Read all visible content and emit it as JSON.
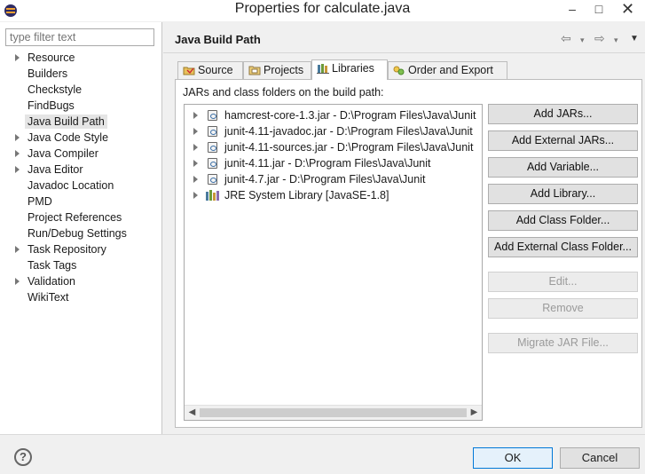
{
  "window": {
    "title": "Properties for calculate.java",
    "minimize": "–",
    "maximize": "□",
    "close": "✕"
  },
  "sidebar": {
    "filter_placeholder": "type filter text",
    "items": [
      {
        "label": "Resource",
        "expandable": true
      },
      {
        "label": "Builders",
        "expandable": false
      },
      {
        "label": "Checkstyle",
        "expandable": false
      },
      {
        "label": "FindBugs",
        "expandable": false
      },
      {
        "label": "Java Build Path",
        "expandable": false,
        "selected": true
      },
      {
        "label": "Java Code Style",
        "expandable": true
      },
      {
        "label": "Java Compiler",
        "expandable": true
      },
      {
        "label": "Java Editor",
        "expandable": true
      },
      {
        "label": "Javadoc Location",
        "expandable": false
      },
      {
        "label": "PMD",
        "expandable": false
      },
      {
        "label": "Project References",
        "expandable": false
      },
      {
        "label": "Run/Debug Settings",
        "expandable": false
      },
      {
        "label": "Task Repository",
        "expandable": true
      },
      {
        "label": "Task Tags",
        "expandable": false
      },
      {
        "label": "Validation",
        "expandable": true
      },
      {
        "label": "WikiText",
        "expandable": false
      }
    ]
  },
  "page": {
    "title": "Java Build Path",
    "nav": {
      "back": "⇦",
      "forward": "⇨",
      "dropdown": "▾",
      "menu": "▼"
    }
  },
  "tabs": [
    {
      "label": "Source",
      "active": false
    },
    {
      "label": "Projects",
      "active": false
    },
    {
      "label": "Libraries",
      "active": true
    },
    {
      "label": "Order and Export",
      "active": false
    }
  ],
  "libraries": {
    "label": "JARs and class folders on the build path:",
    "items": [
      {
        "label": "hamcrest-core-1.3.jar - D:\\Program Files\\Java\\Junit",
        "kind": "jar"
      },
      {
        "label": "junit-4.11-javadoc.jar - D:\\Program Files\\Java\\Junit",
        "kind": "jar"
      },
      {
        "label": "junit-4.11-sources.jar - D:\\Program Files\\Java\\Junit",
        "kind": "jar"
      },
      {
        "label": "junit-4.11.jar - D:\\Program Files\\Java\\Junit",
        "kind": "jar"
      },
      {
        "label": "junit-4.7.jar - D:\\Program Files\\Java\\Junit",
        "kind": "jar"
      },
      {
        "label": "JRE System Library [JavaSE-1.8]",
        "kind": "library"
      }
    ],
    "scroll_left": "◀",
    "scroll_right": "▶"
  },
  "buttons": [
    {
      "label": "Add JARs...",
      "enabled": true
    },
    {
      "label": "Add External JARs...",
      "enabled": true
    },
    {
      "label": "Add Variable...",
      "enabled": true
    },
    {
      "label": "Add Library...",
      "enabled": true
    },
    {
      "label": "Add Class Folder...",
      "enabled": true
    },
    {
      "label": "Add External Class Folder...",
      "enabled": true
    },
    {
      "label": "Edit...",
      "enabled": false
    },
    {
      "label": "Remove",
      "enabled": false
    },
    {
      "label": "Migrate JAR File...",
      "enabled": false
    }
  ],
  "footer": {
    "help": "?",
    "ok": "OK",
    "cancel": "Cancel"
  },
  "colors": {
    "ok_border": "#0078d7",
    "selection": "#e5e5e5",
    "disabled_text": "#9a9a9a"
  }
}
